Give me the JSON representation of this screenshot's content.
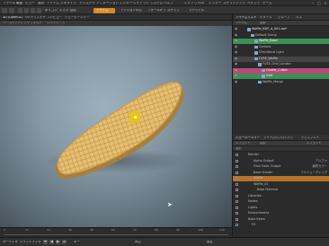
{
  "menubar": {
    "items": [
      "ファイル",
      "編集",
      "ビュー",
      "選択",
      "アイテム",
      "ジオメトリ",
      "テクスチャ",
      "アニメーション",
      "レンダー",
      "レイアウト",
      "システム",
      "ヘルプ"
    ],
    "right_items": [
      "レイアウト",
      "UV",
      "レンダー",
      "スケマティック",
      "ペイント",
      "ゲーム"
    ]
  },
  "toolbar": {
    "labels": [
      "アイテム",
      "ポリゴン",
      "エッジ",
      "頂点",
      "マテリアル",
      "アクション中心",
      "フォールオフ",
      "スナップ"
    ],
    "orange_label": "アイテム"
  },
  "viewport": {
    "tabs": [
      "3D (OpenGL)",
      "UV テクスチャ",
      "プレビュー",
      "シェーダーツリー"
    ],
    "header_items": [
      "パースペクティブ",
      "デフォルト",
      "レイトレース"
    ],
    "colors": {
      "waffle": "#e0b86a",
      "waffle_shadow": "#b08a48",
      "gizmo": "#e6c21a"
    }
  },
  "timeline": {
    "ticks": [
      "0",
      "12",
      "24",
      "36",
      "48",
      "60",
      "72",
      "84",
      "96",
      "108",
      "120"
    ]
  },
  "statusbar": {
    "buttons": [
      "⏮",
      "◀",
      "▶",
      "⏭"
    ],
    "labels": [
      "オーディオ",
      "グラフエディタ",
      "キー",
      "再生",
      "設定"
    ]
  },
  "items_panel": {
    "tabs": [
      "アイテムリスト",
      "イメージ",
      "グループ",
      "パス"
    ],
    "header": [
      "アイテム",
      "名前"
    ],
    "rows": [
      {
        "label": "Waffle_BDP_A_001.lxo*",
        "indent": 8,
        "hl": "",
        "color": "#e8e8e8"
      },
      {
        "label": "Default Group",
        "indent": 12,
        "hl": "",
        "color": "#bdbdbd"
      },
      {
        "label": "Waffle_Base",
        "indent": 16,
        "hl": "green",
        "color": "#ffffff"
      },
      {
        "label": "Camera",
        "indent": 16,
        "hl": "",
        "color": "#bdbdbd"
      },
      {
        "label": "Directional Light",
        "indent": 16,
        "hl": "",
        "color": "#bdbdbd"
      },
      {
        "label": "FUSE_Waffle",
        "indent": 16,
        "hl": "grey",
        "color": "#d5d5d5"
      },
      {
        "label": "FUSE_Grid_Locator",
        "indent": 20,
        "hl": "",
        "color": "#bdbdbd"
      },
      {
        "label": "Cookie_Cutter",
        "indent": 24,
        "hl": "pink",
        "color": "#ffffff"
      },
      {
        "label": "Grid",
        "indent": 24,
        "hl": "green",
        "color": "#ffffff"
      },
      {
        "label": "Waffle_Merge",
        "indent": 20,
        "hl": "",
        "color": "#bdbdbd"
      }
    ]
  },
  "shader_panel": {
    "tabs": [
      "シェーダーツリー",
      "アイテムのプロパティ",
      "ディスプレイ"
    ],
    "header": [
      "エフェクト",
      "名前",
      "エフェクト"
    ],
    "filter": "表示",
    "rows": [
      {
        "label": "Render",
        "indent": 4,
        "hl": "",
        "value": ""
      },
      {
        "label": "Alpha Output",
        "indent": 10,
        "hl": "",
        "value": "アルファ"
      },
      {
        "label": "Final Color Output",
        "indent": 10,
        "hl": "",
        "value": "最終カラー"
      },
      {
        "label": "Base Shader",
        "indent": 10,
        "hl": "",
        "value": "フルシェーディング"
      },
      {
        "label": "Waffle",
        "indent": 10,
        "hl": "orange",
        "value": ""
      },
      {
        "label": "Waffle_01",
        "indent": 10,
        "hl": "",
        "value": ""
      },
      {
        "label": "Base Material",
        "indent": 14,
        "hl": "",
        "value": ""
      },
      {
        "label": "Libraries",
        "indent": 4,
        "hl": "",
        "value": ""
      },
      {
        "label": "Nodes",
        "indent": 4,
        "hl": "",
        "value": ""
      },
      {
        "label": "Lights",
        "indent": 4,
        "hl": "",
        "value": ""
      },
      {
        "label": "Environments",
        "indent": 4,
        "hl": "",
        "value": ""
      },
      {
        "label": "Bake Items",
        "indent": 4,
        "hl": "",
        "value": ""
      },
      {
        "label": "FX",
        "indent": 8,
        "hl": "",
        "value": ""
      }
    ]
  }
}
